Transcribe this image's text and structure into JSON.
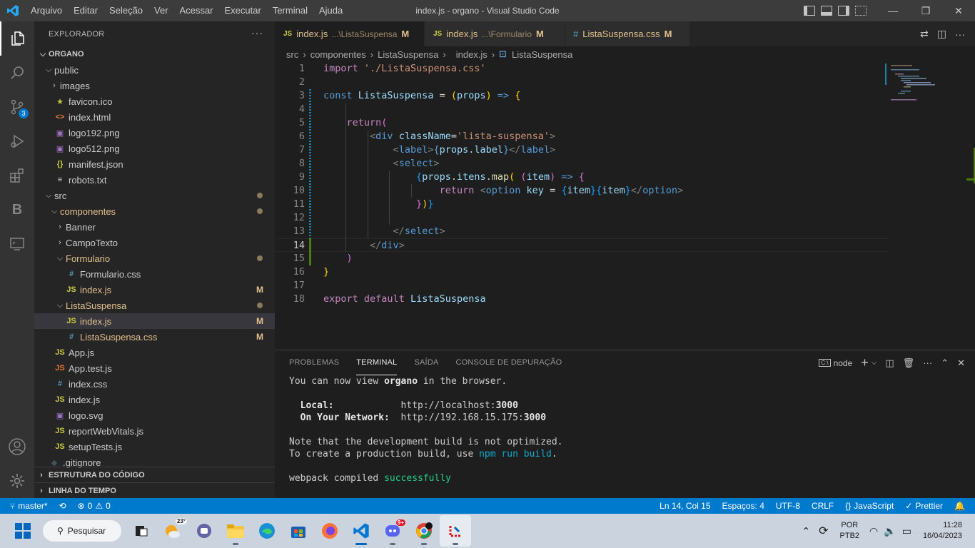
{
  "titlebar": {
    "menu": [
      "Arquivo",
      "Editar",
      "Seleção",
      "Ver",
      "Acessar",
      "Executar",
      "Terminal",
      "Ajuda"
    ],
    "title": "index.js - organo - Visual Studio Code",
    "minimize": "—",
    "restore": "❐",
    "close": "✕"
  },
  "activitybar": {
    "scm_badge": "3",
    "extension_b": "B"
  },
  "sidebar": {
    "header": "EXPLORADOR",
    "more": "···",
    "root": "ORGANO",
    "tree": [
      {
        "label": "public",
        "chev": "⌵",
        "icon": "",
        "indent": 1
      },
      {
        "label": "images",
        "chev": "›",
        "icon": "",
        "indent": 2
      },
      {
        "label": "favicon.ico",
        "chev": "",
        "icon": "★",
        "icon_color": "#cbcb41",
        "indent": 2
      },
      {
        "label": "index.html",
        "chev": "",
        "icon": "<>",
        "icon_color": "#e37933",
        "indent": 2
      },
      {
        "label": "logo192.png",
        "chev": "",
        "icon": "▣",
        "icon_color": "#a074c4",
        "indent": 2
      },
      {
        "label": "logo512.png",
        "chev": "",
        "icon": "▣",
        "icon_color": "#a074c4",
        "indent": 2
      },
      {
        "label": "manifest.json",
        "chev": "",
        "icon": "{}",
        "icon_color": "#cbcb41",
        "indent": 2
      },
      {
        "label": "robots.txt",
        "chev": "",
        "icon": "≡",
        "icon_color": "#cccccc",
        "indent": 2
      },
      {
        "label": "src",
        "chev": "⌵",
        "icon": "",
        "indent": 1,
        "dot": true
      },
      {
        "label": "componentes",
        "chev": "⌵",
        "icon": "",
        "indent": 2,
        "mod": true,
        "dot": true
      },
      {
        "label": "Banner",
        "chev": "›",
        "icon": "",
        "indent": 3
      },
      {
        "label": "CampoTexto",
        "chev": "›",
        "icon": "",
        "indent": 3
      },
      {
        "label": "Formulario",
        "chev": "⌵",
        "icon": "",
        "indent": 3,
        "mod": true,
        "dot": true
      },
      {
        "label": "Formulario.css",
        "chev": "",
        "icon": "#",
        "icon_color": "#519aba",
        "indent": 4
      },
      {
        "label": "index.js",
        "chev": "",
        "icon": "JS",
        "icon_color": "#cbcb41",
        "indent": 4,
        "mod": true,
        "deco": "M"
      },
      {
        "label": "ListaSuspensa",
        "chev": "⌵",
        "icon": "",
        "indent": 3,
        "mod": true,
        "dot": true
      },
      {
        "label": "index.js",
        "chev": "",
        "icon": "JS",
        "icon_color": "#cbcb41",
        "indent": 4,
        "mod": true,
        "deco": "M",
        "selected": true
      },
      {
        "label": "ListaSuspensa.css",
        "chev": "",
        "icon": "#",
        "icon_color": "#519aba",
        "indent": 4,
        "mod": true,
        "deco": "M"
      },
      {
        "label": "App.js",
        "chev": "",
        "icon": "JS",
        "icon_color": "#cbcb41",
        "indent": 2
      },
      {
        "label": "App.test.js",
        "chev": "",
        "icon": "JS",
        "icon_color": "#e37933",
        "indent": 2
      },
      {
        "label": "index.css",
        "chev": "",
        "icon": "#",
        "icon_color": "#519aba",
        "indent": 2
      },
      {
        "label": "index.js",
        "chev": "",
        "icon": "JS",
        "icon_color": "#cbcb41",
        "indent": 2
      },
      {
        "label": "logo.svg",
        "chev": "",
        "icon": "▣",
        "icon_color": "#a074c4",
        "indent": 2
      },
      {
        "label": "reportWebVitals.js",
        "chev": "",
        "icon": "JS",
        "icon_color": "#cbcb41",
        "indent": 2
      },
      {
        "label": "setupTests.js",
        "chev": "",
        "icon": "JS",
        "icon_color": "#cbcb41",
        "indent": 2
      },
      {
        "label": ".gitignore",
        "chev": "",
        "icon": "◆",
        "icon_color": "#41535b",
        "indent": 1
      }
    ],
    "outline": "ESTRUTURA DO CÓDIGO",
    "timeline": "LINHA DO TEMPO"
  },
  "tabs": [
    {
      "name": "index.js",
      "desc": "...\\ListaSuspensa",
      "mod": "M",
      "kind": "JS",
      "active": true
    },
    {
      "name": "index.js",
      "desc": "...\\Formulario",
      "mod": "M",
      "kind": "JS",
      "active": false
    },
    {
      "name": "ListaSuspensa.css",
      "desc": "",
      "mod": "M",
      "kind": "#",
      "active": false
    }
  ],
  "breadcrumb": [
    "src",
    "componentes",
    "ListaSuspensa",
    "index.js",
    "ListaSuspensa"
  ],
  "code": {
    "current_line": 14,
    "lines": [
      [
        [
          "k",
          "import"
        ],
        [
          "p",
          " "
        ],
        [
          "s",
          "'./ListaSuspensa.css'"
        ]
      ],
      [],
      [
        [
          "k2",
          "const"
        ],
        [
          "p",
          " "
        ],
        [
          "v",
          "ListaSuspensa"
        ],
        [
          "p",
          " = "
        ],
        [
          "b1",
          "("
        ],
        [
          "v",
          "props"
        ],
        [
          "b1",
          ")"
        ],
        [
          "p",
          " "
        ],
        [
          "k2",
          "=>"
        ],
        [
          "p",
          " "
        ],
        [
          "b1",
          "{"
        ]
      ],
      [],
      [
        [
          "p",
          "    "
        ],
        [
          "k",
          "return"
        ],
        [
          "b2",
          "("
        ]
      ],
      [
        [
          "p",
          "        "
        ],
        [
          "g",
          "<"
        ],
        [
          "t",
          "div"
        ],
        [
          "p",
          " "
        ],
        [
          "a",
          "className"
        ],
        [
          "p",
          "="
        ],
        [
          "s",
          "'lista-suspensa'"
        ],
        [
          "g",
          ">"
        ]
      ],
      [
        [
          "p",
          "            "
        ],
        [
          "g",
          "<"
        ],
        [
          "t",
          "label"
        ],
        [
          "g",
          ">"
        ],
        [
          "k2",
          "{"
        ],
        [
          "v",
          "props"
        ],
        [
          "p",
          "."
        ],
        [
          "v",
          "label"
        ],
        [
          "k2",
          "}"
        ],
        [
          "g",
          "</"
        ],
        [
          "t",
          "label"
        ],
        [
          "g",
          ">"
        ]
      ],
      [
        [
          "p",
          "            "
        ],
        [
          "g",
          "<"
        ],
        [
          "t",
          "select"
        ],
        [
          "g",
          ">"
        ]
      ],
      [
        [
          "p",
          "                "
        ],
        [
          "b3",
          "{"
        ],
        [
          "v",
          "props"
        ],
        [
          "p",
          "."
        ],
        [
          "v",
          "itens"
        ],
        [
          "p",
          "."
        ],
        [
          "f",
          "map"
        ],
        [
          "b1",
          "("
        ],
        [
          "p",
          " "
        ],
        [
          "b2",
          "("
        ],
        [
          "v",
          "item"
        ],
        [
          "b2",
          ")"
        ],
        [
          "p",
          " "
        ],
        [
          "k2",
          "=>"
        ],
        [
          "p",
          " "
        ],
        [
          "b2",
          "{"
        ]
      ],
      [
        [
          "p",
          "                    "
        ],
        [
          "k",
          "return"
        ],
        [
          "p",
          " "
        ],
        [
          "g",
          "<"
        ],
        [
          "t",
          "option"
        ],
        [
          "p",
          " "
        ],
        [
          "a",
          "key"
        ],
        [
          "p",
          " = "
        ],
        [
          "b3",
          "{"
        ],
        [
          "v",
          "item"
        ],
        [
          "b3",
          "}"
        ],
        [
          "b3",
          "{"
        ],
        [
          "v",
          "item"
        ],
        [
          "b3",
          "}"
        ],
        [
          "g",
          "</"
        ],
        [
          "t",
          "option"
        ],
        [
          "g",
          ">"
        ]
      ],
      [
        [
          "p",
          "                "
        ],
        [
          "b2",
          "}"
        ],
        [
          "b1",
          ")"
        ],
        [
          "b3",
          "}"
        ]
      ],
      [],
      [
        [
          "p",
          "            "
        ],
        [
          "g",
          "</"
        ],
        [
          "t",
          "select"
        ],
        [
          "g",
          ">"
        ]
      ],
      [
        [
          "p",
          "        "
        ],
        [
          "g",
          "</"
        ],
        [
          "t",
          "div"
        ],
        [
          "g",
          ">"
        ]
      ],
      [
        [
          "p",
          "    "
        ],
        [
          "b2",
          ")"
        ]
      ],
      [
        [
          "b1",
          "}"
        ]
      ],
      [],
      [
        [
          "k",
          "export"
        ],
        [
          "p",
          " "
        ],
        [
          "k",
          "default"
        ],
        [
          "p",
          " "
        ],
        [
          "v",
          "ListaSuspensa"
        ]
      ]
    ]
  },
  "panel": {
    "tabs": [
      "PROBLEMAS",
      "TERMINAL",
      "SAÍDA",
      "CONSOLE DE DEPURAÇÃO"
    ],
    "active_tab": "TERMINAL",
    "shell": "node",
    "terminal": [
      [
        [
          "n",
          "You can now view "
        ],
        [
          "bold",
          "organo"
        ],
        [
          "n",
          " in the browser."
        ]
      ],
      [],
      [
        [
          "n",
          "  "
        ],
        [
          "bold",
          "Local:"
        ],
        [
          "n",
          "            http://localhost:"
        ],
        [
          "bold",
          "3000"
        ]
      ],
      [
        [
          "n",
          "  "
        ],
        [
          "bold",
          "On Your Network:"
        ],
        [
          "n",
          "  http://192.168.15.175:"
        ],
        [
          "bold",
          "3000"
        ]
      ],
      [],
      [
        [
          "n",
          "Note that the development build is not optimized."
        ]
      ],
      [
        [
          "n",
          "To create a production build, use "
        ],
        [
          "cyan",
          "npm run build"
        ],
        [
          "n",
          "."
        ]
      ],
      [],
      [
        [
          "n",
          "webpack compiled "
        ],
        [
          "green",
          "successfully"
        ]
      ]
    ]
  },
  "statusbar": {
    "branch": "master*",
    "errors": "0",
    "warnings": "0",
    "position": "Ln 14, Col 15",
    "spaces": "Espaços: 4",
    "encoding": "UTF-8",
    "eol": "CRLF",
    "language": "JavaScript",
    "formatter": "Prettier"
  },
  "taskbar": {
    "search": "Pesquisar",
    "weather": "23°",
    "discord_badge": "9+",
    "lang_top": "POR",
    "lang_bottom": "PTB2",
    "time": "11:28",
    "date": "16/04/2023"
  },
  "colors": {
    "accent": "#007acc",
    "modified": "#e2c08d",
    "taskbar": "#cbd3df"
  }
}
